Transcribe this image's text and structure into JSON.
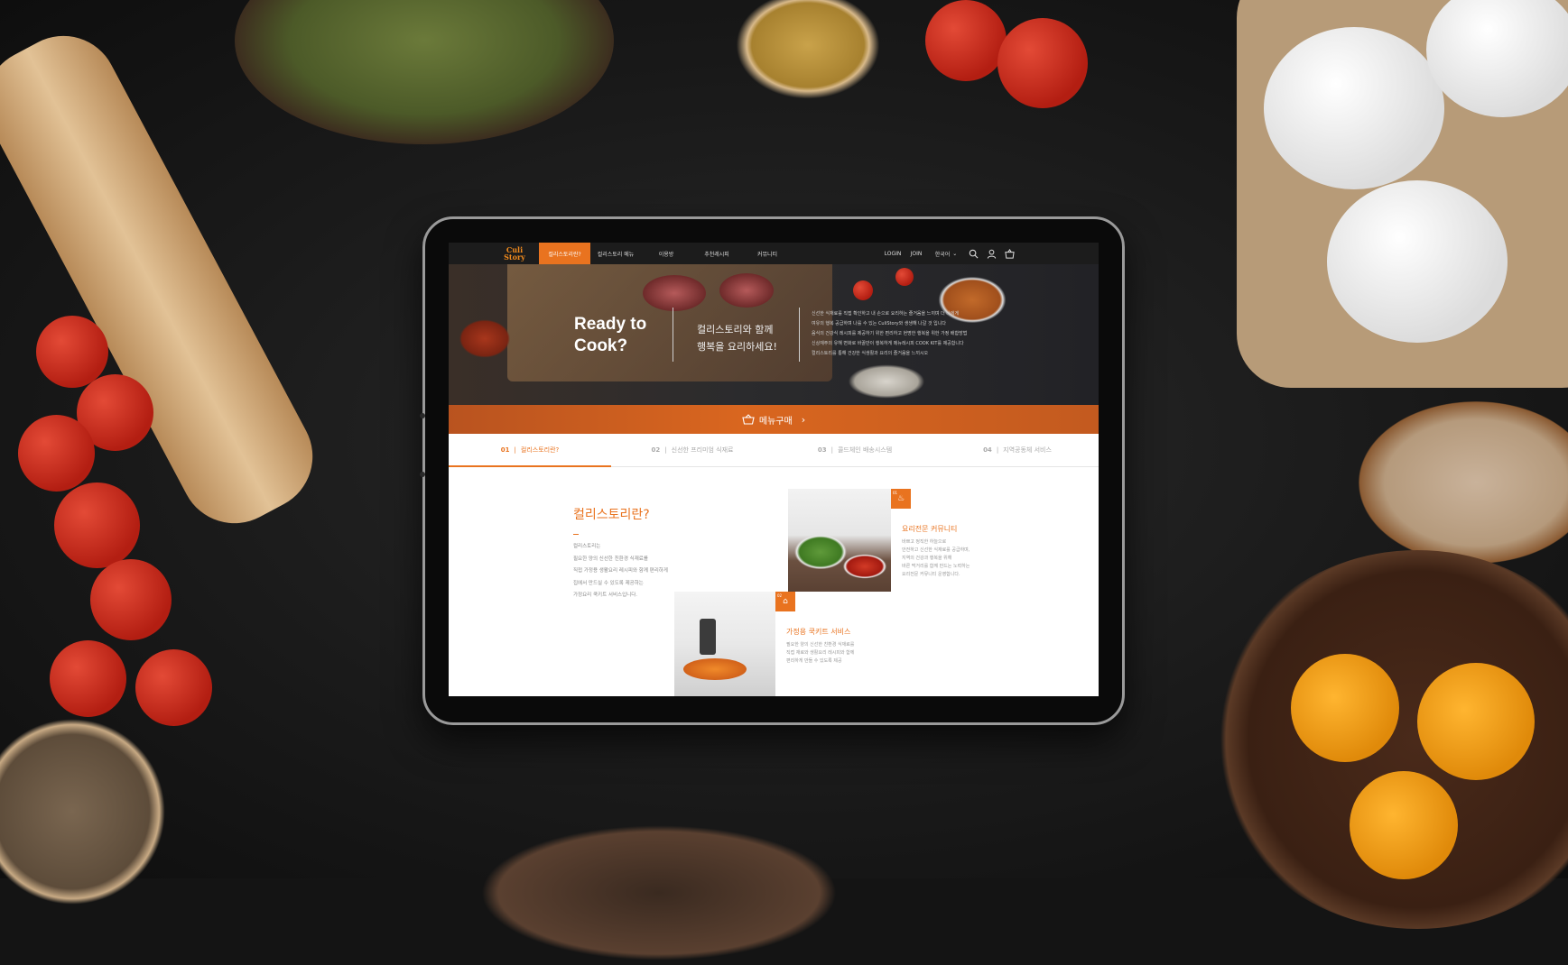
{
  "nav": {
    "logo": "Culi Story",
    "items": [
      {
        "label": "컬리스토리란?",
        "active": true
      },
      {
        "label": "컬리스토리 메뉴",
        "active": false
      },
      {
        "label": "이용방",
        "active": false
      },
      {
        "label": "추천레시피",
        "active": false
      },
      {
        "label": "커뮤니티",
        "active": false
      }
    ],
    "login": "LOGIN",
    "join": "JOIN",
    "language": "한국어"
  },
  "hero": {
    "title_line1": "Ready to",
    "title_line2": "Cook?",
    "subtitle_line1": "컬리스토리와 함께",
    "subtitle_line2": "행복을 요리하세요!",
    "description": [
      "신선한 식재료를 직접 확인하고 내 손으로 요리하는 즐거움을 느끼며 더 나에게",
      "여유의 행복 공급하며 나를 수 있는 CuliStory와 생생해 나갈 것 입니다",
      "음식의 건강식 레시피를 제공하기 위한 편리하고 현명한 행복을 위한 가정 배합방법",
      "신상재주의 유해 변화로 바꿀만이 행복하게 메뉴레시피 COOK KIT를 제공합니다",
      "컬리스토리를 통해 건강한 식생활과 요리의 즐거움을 느끼시오"
    ],
    "cta": "메뉴구매"
  },
  "steps": [
    {
      "num": "01",
      "label": "컬리스토리란?",
      "active": true
    },
    {
      "num": "02",
      "label": "신선한 프리미엄 식재료",
      "active": false
    },
    {
      "num": "03",
      "label": "콜드체인 배송시스템",
      "active": false
    },
    {
      "num": "04",
      "label": "지역공동체 서비스",
      "active": false
    }
  ],
  "section": {
    "title": "컬리스토리란?",
    "body": [
      "컬리스토리는",
      "필요한 양의 신선한 친환경 식재료를",
      "직접 가정용 생활요리 레시피와 함께 편리하게",
      "집에서 만드실 수 있도록 제공하는",
      "가정요리 쿡키트 서비스입니다."
    ]
  },
  "features": [
    {
      "badge": "01",
      "title": "요리전문 커뮤니티",
      "text": [
        "바쁘고 정직한 하늘으로",
        "안전하고 신선한 식재료를 공급하며,",
        "지역의 건강과 행복을 위해",
        "바른 먹거리를 함께 만드는 노력하는",
        "요리전문 커뮤니티 운영합니다."
      ]
    },
    {
      "badge": "02",
      "title": "가정용 쿡키트 서비스",
      "text": [
        "필요한 양의 신선한 친환경 식재료를",
        "직접 재료와 생활요리 레시피와 함께",
        "편리하게 만들 수 있도록 제공"
      ]
    }
  ],
  "colors": {
    "accent": "#e9731f",
    "nav_bg": "#1c1c1c",
    "background": "#141414"
  }
}
